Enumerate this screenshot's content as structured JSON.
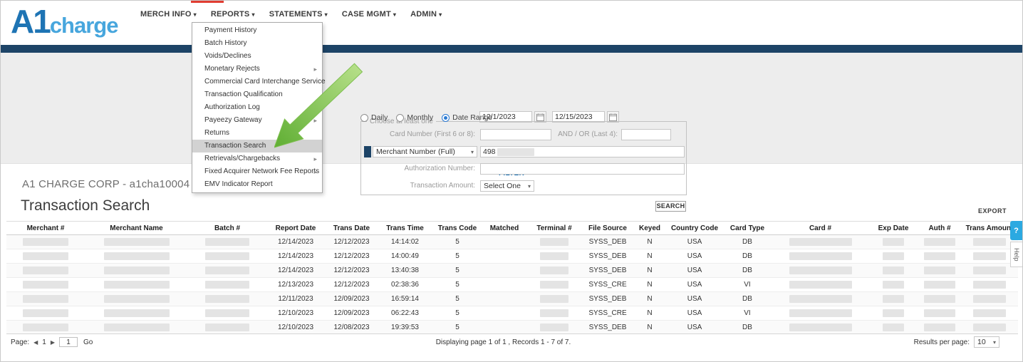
{
  "brand": {
    "logo_text_bold": "A1",
    "logo_text_light": "charge"
  },
  "nav": {
    "items": [
      "MERCH INFO",
      "REPORTS",
      "STATEMENTS",
      "CASE MGMT",
      "ADMIN"
    ]
  },
  "reports_menu": {
    "items": [
      {
        "label": "Payment History",
        "submenu": false,
        "highlighted": false
      },
      {
        "label": "Batch History",
        "submenu": false,
        "highlighted": false
      },
      {
        "label": "Voids/Declines",
        "submenu": false,
        "highlighted": false
      },
      {
        "label": "Monetary Rejects",
        "submenu": true,
        "highlighted": false
      },
      {
        "label": "Commercial Card Interchange Service",
        "submenu": false,
        "highlighted": false
      },
      {
        "label": "Transaction Qualification",
        "submenu": false,
        "highlighted": false
      },
      {
        "label": "Authorization Log",
        "submenu": true,
        "highlighted": false
      },
      {
        "label": "Payeezy Gateway",
        "submenu": true,
        "highlighted": false
      },
      {
        "label": "Returns",
        "submenu": false,
        "highlighted": false
      },
      {
        "label": "Transaction Search",
        "submenu": false,
        "highlighted": true
      },
      {
        "label": "Retrievals/Chargebacks",
        "submenu": true,
        "highlighted": false
      },
      {
        "label": "Fixed Acquirer Network Fee Reports",
        "submenu": true,
        "highlighted": false
      },
      {
        "label": "EMV Indicator Report",
        "submenu": false,
        "highlighted": false
      }
    ]
  },
  "filter": {
    "radios": [
      {
        "label": "Daily",
        "selected": false
      },
      {
        "label": "Monthly",
        "selected": false
      },
      {
        "label": "Date Range",
        "selected": true
      }
    ],
    "date_from": "12/1/2023",
    "date_to": "12/15/2023",
    "legend": "Choose at least one",
    "card_number_label": "Card Number (First 6 or 8):",
    "and_or_label": "AND / OR  (Last 4):",
    "merchant_select_value": "Merchant Number (Full)",
    "merchant_number_value": "498",
    "auth_number_label": "Authorization Number:",
    "trans_amount_label": "Transaction Amount:",
    "trans_amount_value": "Select One",
    "search_button": "SEARCH"
  },
  "filter_link": "FILTER",
  "page_info": {
    "company": "A1 CHARGE CORP - a1cha10004",
    "title": "Transaction Search",
    "export": "EXPORT"
  },
  "table": {
    "columns": [
      "Merchant #",
      "Merchant Name",
      "Batch #",
      "Report Date",
      "Trans Date",
      "Trans Time",
      "Trans Code",
      "Matched",
      "Terminal #",
      "File Source",
      "Keyed",
      "Country Code",
      "Card Type",
      "Card #",
      "Exp Date",
      "Auth #",
      "Trans Amount"
    ],
    "rows": [
      [
        null,
        null,
        null,
        "12/14/2023",
        "12/12/2023",
        "14:14:02",
        "5",
        "",
        null,
        "SYSS_DEB",
        "N",
        "USA",
        "DB",
        null,
        null,
        null,
        null
      ],
      [
        null,
        null,
        null,
        "12/14/2023",
        "12/12/2023",
        "14:00:49",
        "5",
        "",
        null,
        "SYSS_DEB",
        "N",
        "USA",
        "DB",
        null,
        null,
        null,
        null
      ],
      [
        null,
        null,
        null,
        "12/14/2023",
        "12/12/2023",
        "13:40:38",
        "5",
        "",
        null,
        "SYSS_DEB",
        "N",
        "USA",
        "DB",
        null,
        null,
        null,
        null
      ],
      [
        null,
        null,
        null,
        "12/13/2023",
        "12/12/2023",
        "02:38:36",
        "5",
        "",
        null,
        "SYSS_CRE",
        "N",
        "USA",
        "VI",
        null,
        null,
        null,
        null
      ],
      [
        null,
        null,
        null,
        "12/11/2023",
        "12/09/2023",
        "16:59:14",
        "5",
        "",
        null,
        "SYSS_DEB",
        "N",
        "USA",
        "DB",
        null,
        null,
        null,
        null
      ],
      [
        null,
        null,
        null,
        "12/10/2023",
        "12/09/2023",
        "06:22:43",
        "5",
        "",
        null,
        "SYSS_CRE",
        "N",
        "USA",
        "VI",
        null,
        null,
        null,
        null
      ],
      [
        null,
        null,
        null,
        "12/10/2023",
        "12/08/2023",
        "19:39:53",
        "5",
        "",
        null,
        "SYSS_DEB",
        "N",
        "USA",
        "DB",
        null,
        null,
        null,
        null
      ]
    ]
  },
  "pagination": {
    "page_label": "Page:",
    "current_page": "1",
    "page_input": "1",
    "go_label": "Go",
    "summary": "Displaying page 1 of 1 , Records 1 - 7 of 7.",
    "rpp_label": "Results per page:",
    "rpp_value": "10"
  },
  "help": {
    "icon": "?",
    "label": "Help"
  },
  "colors": {
    "brand_blue": "#1e74b4",
    "brand_light_blue": "#47a6dd",
    "navy_bar": "#1d4467",
    "link_blue": "#0d6cb5",
    "menu_highlight": "#d2d2d2",
    "annotation_green": "#6fb33a",
    "active_nav_red": "#e03c31",
    "help_tab_blue": "#2ba9e1"
  }
}
